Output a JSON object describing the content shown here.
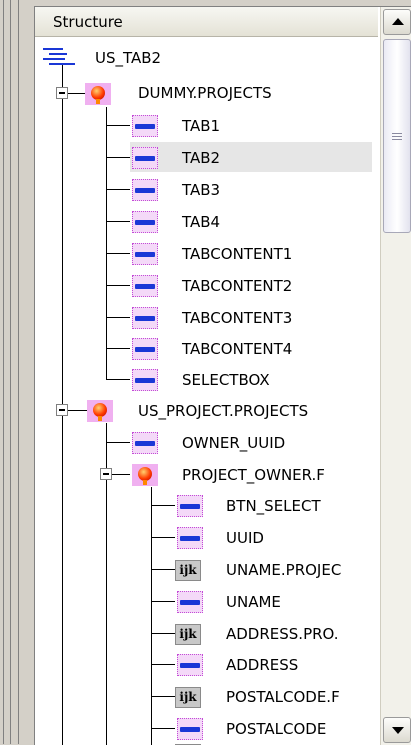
{
  "panel": {
    "header_title": "Structure"
  },
  "tree": {
    "root": {
      "label": "US_TAB2",
      "icon": "structure-icon"
    },
    "group1": {
      "label": "DUMMY.PROJECTS",
      "icon": "table-icon",
      "children": [
        {
          "label": "TAB1",
          "icon": "field-icon"
        },
        {
          "label": "TAB2",
          "icon": "field-icon",
          "selected": true
        },
        {
          "label": "TAB3",
          "icon": "field-icon"
        },
        {
          "label": "TAB4",
          "icon": "field-icon"
        },
        {
          "label": "TABCONTENT1",
          "icon": "field-icon"
        },
        {
          "label": "TABCONTENT2",
          "icon": "field-icon"
        },
        {
          "label": "TABCONTENT3",
          "icon": "field-icon"
        },
        {
          "label": "TABCONTENT4",
          "icon": "field-icon"
        },
        {
          "label": "SELECTBOX",
          "icon": "field-icon"
        }
      ]
    },
    "group2": {
      "label": "US_PROJECT.PROJECTS",
      "icon": "table-icon",
      "children": [
        {
          "label": "OWNER_UUID",
          "icon": "field-icon"
        }
      ],
      "subgroup": {
        "label": "PROJECT_OWNER.F",
        "icon": "table-icon",
        "children": [
          {
            "label": "BTN_SELECT",
            "icon": "field-icon"
          },
          {
            "label": "UUID",
            "icon": "field-icon"
          },
          {
            "label": "UNAME.PROJEC",
            "icon": "label-icon",
            "icon_text": "ijk"
          },
          {
            "label": "UNAME",
            "icon": "field-icon"
          },
          {
            "label": "ADDRESS.PRO.",
            "icon": "label-icon",
            "icon_text": "ijk"
          },
          {
            "label": "ADDRESS",
            "icon": "field-icon"
          },
          {
            "label": "POSTALCODE.F",
            "icon": "label-icon",
            "icon_text": "ijk"
          },
          {
            "label": "POSTALCODE",
            "icon": "field-icon"
          }
        ]
      }
    }
  },
  "colors": {
    "field_bar": "#1a37d6",
    "selection": "#e6e6e6"
  }
}
